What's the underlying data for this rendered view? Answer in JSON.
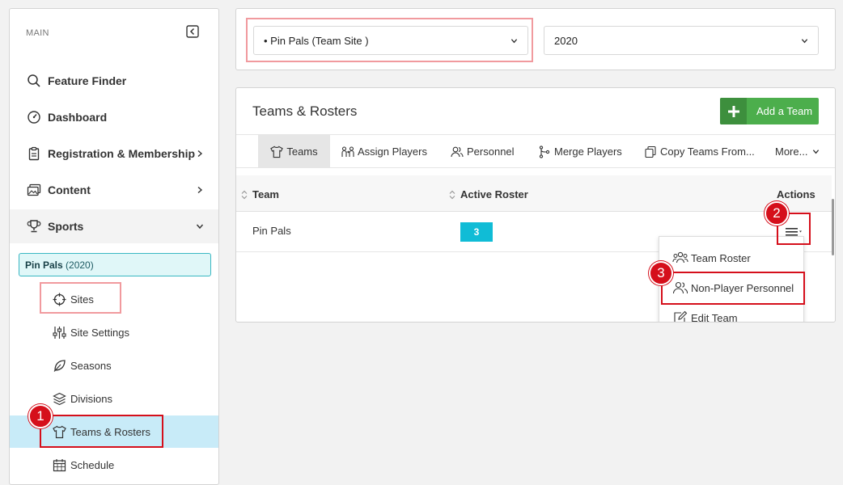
{
  "sidebar": {
    "header": "MAIN",
    "items": [
      {
        "label": "Feature Finder",
        "icon": "search-icon"
      },
      {
        "label": "Dashboard",
        "icon": "dashboard-gauge-icon"
      },
      {
        "label": "Registration & Membership",
        "icon": "clipboard-icon"
      },
      {
        "label": "Content",
        "icon": "images-icon"
      },
      {
        "label": "Sports",
        "icon": "trophy-icon"
      }
    ],
    "team_chip": {
      "name": "Pin Pals",
      "season": "(2020)"
    },
    "sub_items": [
      {
        "label": "Sites",
        "icon": "crosshair-icon"
      },
      {
        "label": "Site Settings",
        "icon": "sliders-icon"
      },
      {
        "label": "Seasons",
        "icon": "leaf-icon"
      },
      {
        "label": "Divisions",
        "icon": "layers-icon"
      },
      {
        "label": "Teams & Rosters",
        "icon": "shirt-icon"
      },
      {
        "label": "Schedule",
        "icon": "calendar-icon"
      }
    ]
  },
  "filters": {
    "site_select": "• Pin Pals (Team Site )",
    "year_select": "2020"
  },
  "card": {
    "title": "Teams & Rosters",
    "add_button": "Add a Team",
    "tabs": [
      {
        "label": "Teams",
        "icon": "shirt-icon"
      },
      {
        "label": "Assign Players",
        "icon": "assign-players-icon"
      },
      {
        "label": "Personnel",
        "icon": "users-icon"
      },
      {
        "label": "Merge Players",
        "icon": "merge-icon"
      },
      {
        "label": "Copy Teams From...",
        "icon": "copy-icon"
      },
      {
        "label": "More...",
        "icon": "chevron-down-icon"
      }
    ],
    "table": {
      "columns": [
        "Team",
        "Active Roster",
        "Actions"
      ],
      "rows": [
        {
          "team": "Pin Pals",
          "active_roster": "3"
        }
      ]
    },
    "actions_menu": [
      {
        "label": "Team Roster",
        "icon": "team-roster-icon"
      },
      {
        "label": "Non-Player Personnel",
        "icon": "users-icon"
      },
      {
        "label": "Edit Team",
        "icon": "edit-icon"
      }
    ]
  },
  "steps": [
    "1",
    "2",
    "3"
  ],
  "colors": {
    "accent_green": "#4cae4c",
    "roster_badge": "#10bcd6",
    "highlight_red": "#d50f1b",
    "highlight_pink": "#f19a9e",
    "selected_nav": "#c8ebf8"
  }
}
